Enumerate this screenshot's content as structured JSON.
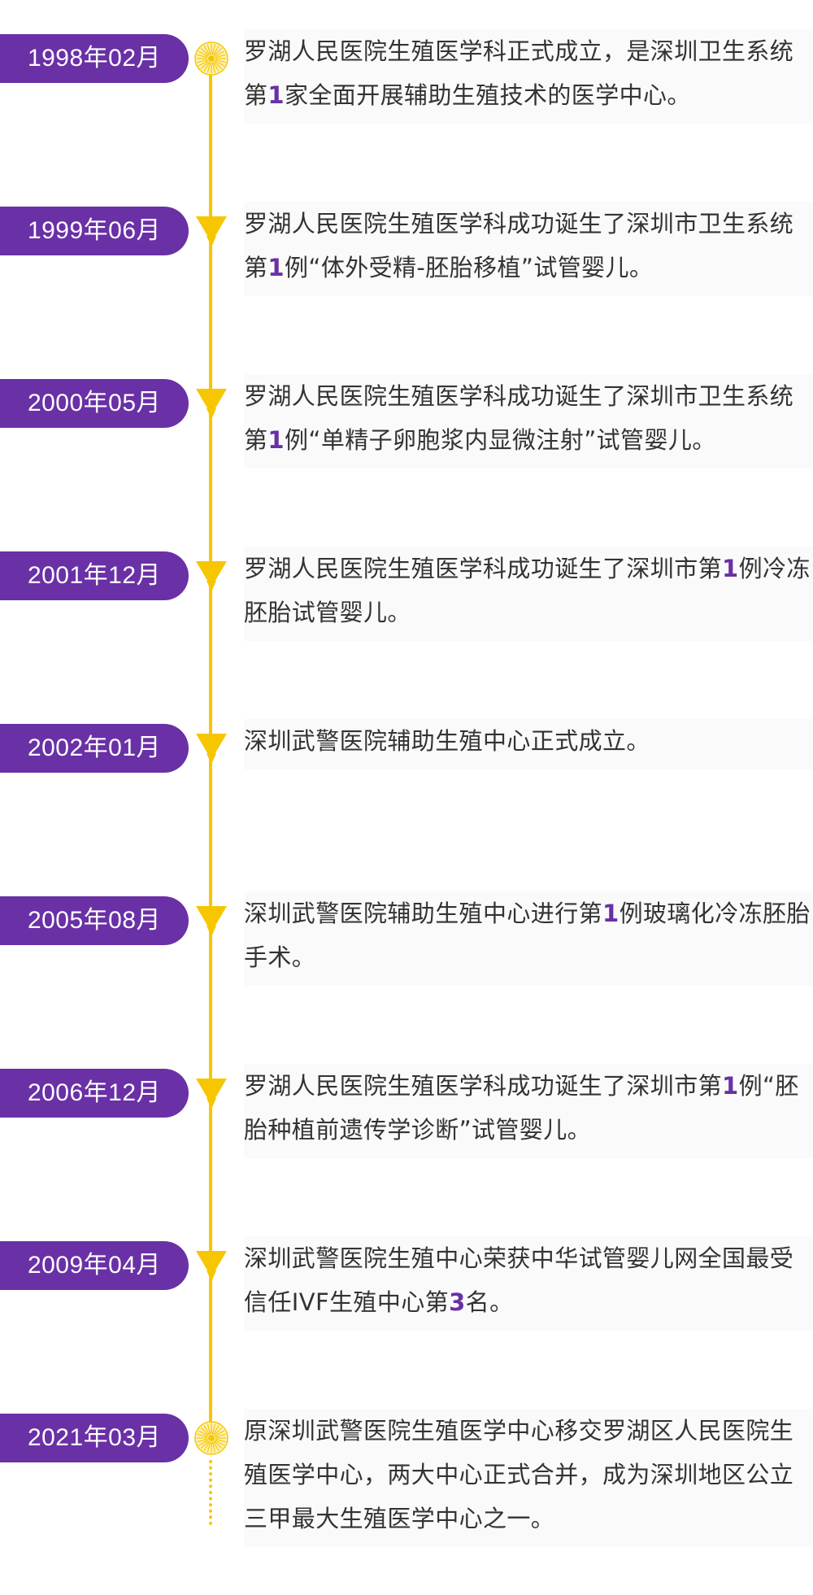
{
  "colors": {
    "accent_purple": "#6a30a6",
    "timeline_yellow": "#f6c600",
    "text": "#333333",
    "pill_text": "#ffffff"
  },
  "entries": [
    {
      "date": "1998年02月",
      "marker": "sunburst-icon",
      "text_before": "罗湖人民医院生殖医学科正式成立，是深圳卫生系统第",
      "highlight": "1",
      "text_after": "家全面开展辅助生殖技术的医学中心。"
    },
    {
      "date": "1999年06月",
      "marker": "arrow-down-icon",
      "text_before": "罗湖人民医院生殖医学科成功诞生了深圳市卫生系统第",
      "highlight": "1",
      "text_after": "例“体外受精-胚胎移植”试管婴儿。"
    },
    {
      "date": "2000年05月",
      "marker": "arrow-down-icon",
      "text_before": "罗湖人民医院生殖医学科成功诞生了深圳市卫生系统第",
      "highlight": "1",
      "text_after": "例“单精子卵胞浆内显微注射”试管婴儿。"
    },
    {
      "date": "2001年12月",
      "marker": "arrow-down-icon",
      "text_before": "罗湖人民医院生殖医学科成功诞生了深圳市第",
      "highlight": "1",
      "text_after": "例冷冻胚胎试管婴儿。"
    },
    {
      "date": "2002年01月",
      "marker": "arrow-down-icon",
      "text_before": "深圳武警医院辅助生殖中心正式成立。",
      "highlight": "",
      "text_after": ""
    },
    {
      "date": "2005年08月",
      "marker": "arrow-down-icon",
      "text_before": "深圳武警医院辅助生殖中心进行第",
      "highlight": "1",
      "text_after": "例玻璃化冷冻胚胎手术。"
    },
    {
      "date": "2006年12月",
      "marker": "arrow-down-icon",
      "text_before": "罗湖人民医院生殖医学科成功诞生了深圳市第",
      "highlight": "1",
      "text_after": "例“胚胎种植前遗传学诊断”试管婴儿。"
    },
    {
      "date": "2009年04月",
      "marker": "arrow-down-icon",
      "text_before": "深圳武警医院生殖中心荣获中华试管婴儿网全国最受信任IVF生殖中心第",
      "highlight": "3",
      "text_after": "名。"
    },
    {
      "date": "2021年03月",
      "marker": "sunburst-icon",
      "text_before": "原深圳武警医院生殖医学中心移交罗湖区人民医院生殖医学中心，两大中心正式合并，成为深圳地区公立三甲最大生殖医学中心之一。",
      "highlight": "",
      "text_after": ""
    }
  ]
}
